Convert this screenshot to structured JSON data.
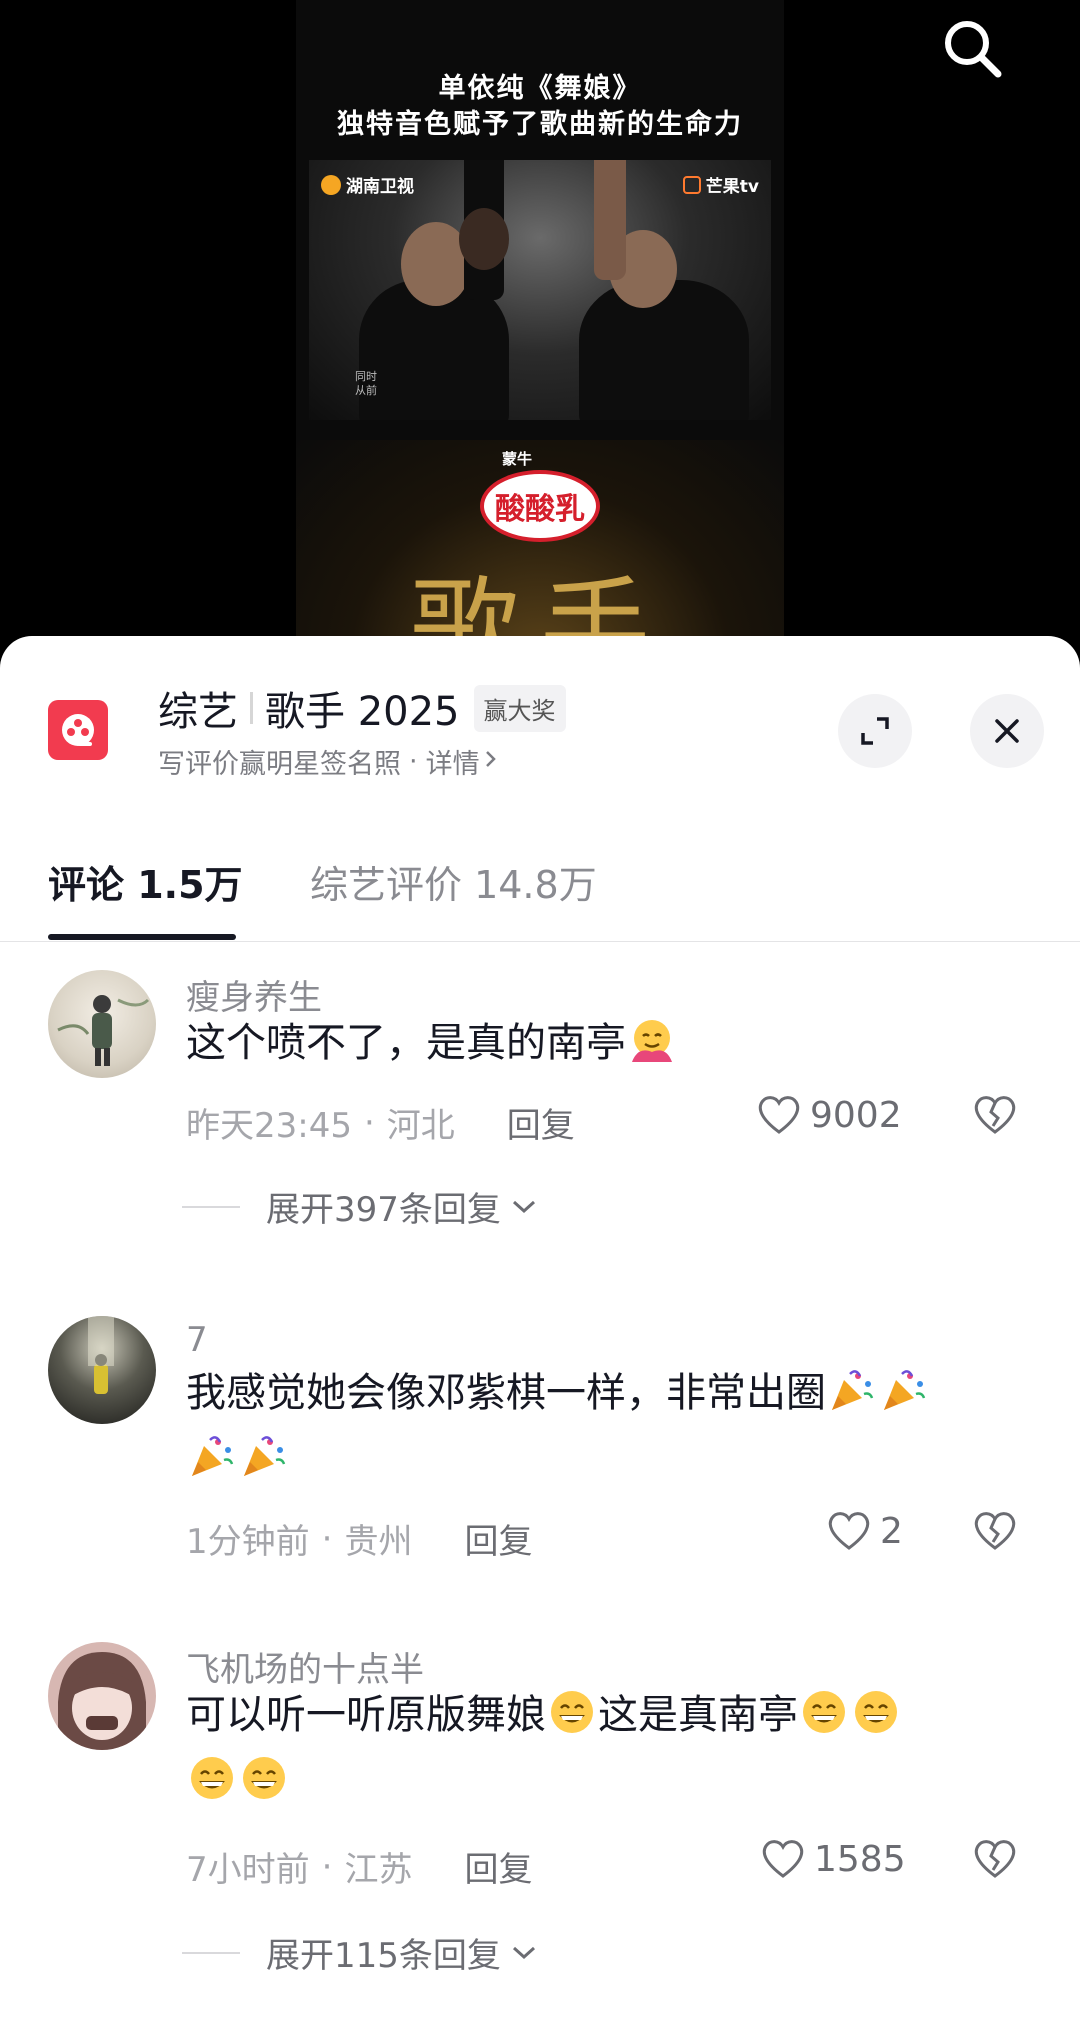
{
  "video": {
    "caption_line1": "单依纯《舞娘》",
    "caption_line2": "独特音色赋予了歌曲新的生命力",
    "watermark_left": "湖南卫视",
    "watermark_right": "芒果tv",
    "stage_small_text": "同时\n从前",
    "sponsor_small": "蒙牛",
    "sponsor_badge": "酸酸乳",
    "show_logo_text": "歌手"
  },
  "header": {
    "category": "综艺",
    "show_name": "歌手 2025",
    "prize_tag": "赢大奖",
    "subtitle": "写评价赢明星签名照",
    "details_link": "详情",
    "subtitle_dot": "·"
  },
  "tabs": [
    {
      "label": "评论 1.5万"
    },
    {
      "label": "综艺评价 14.8万"
    }
  ],
  "comments": [
    {
      "nickname": "瘦身养生",
      "text": "这个喷不了，是真的南亭",
      "emojis": [
        "hug-emoji"
      ],
      "time": "昨天23:45",
      "location": "河北",
      "reply_label": "回复",
      "likes": "9002",
      "expand": "展开397条回复"
    },
    {
      "nickname": "7",
      "text": "我感觉她会像邓紫棋一样，非常出圈",
      "emojis": [
        "party-popper-emoji",
        "party-popper-emoji",
        "party-popper-emoji",
        "party-popper-emoji"
      ],
      "time": "1分钟前",
      "location": "贵州",
      "reply_label": "回复",
      "likes": "2"
    },
    {
      "nickname": "飞机场的十点半",
      "text_part1": "可以听一听原版舞娘",
      "text_part2": "这是真南亭",
      "emojis": [
        "grin-emoji",
        "grin-emoji",
        "grin-emoji",
        "grin-emoji",
        "grin-emoji"
      ],
      "time": "7小时前",
      "location": "江苏",
      "reply_label": "回复",
      "likes": "1585",
      "expand": "展开115条回复"
    }
  ],
  "meta_separator": "·",
  "colors": {
    "accent_red": "#f23b4f",
    "text_primary": "#161823",
    "text_secondary": "#8a8b91"
  }
}
